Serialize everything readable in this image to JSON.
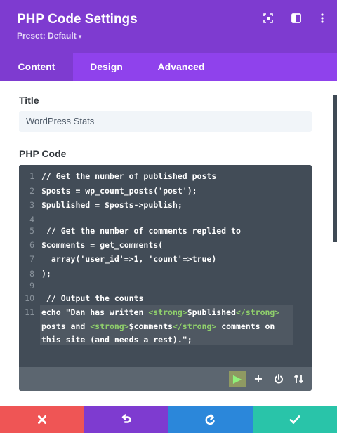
{
  "header": {
    "title": "PHP Code Settings",
    "preset": "Preset: Default",
    "preset_caret": "▾",
    "icons": [
      "focus-icon",
      "split-view-icon",
      "more-options-icon"
    ]
  },
  "tabs": [
    {
      "label": "Content",
      "active": true
    },
    {
      "label": "Design",
      "active": false
    },
    {
      "label": "Advanced",
      "active": false
    }
  ],
  "content": {
    "title_label": "Title",
    "title_value": "WordPress Stats",
    "code_label": "PHP Code",
    "code_lines": [
      {
        "n": "1",
        "text": "// Get the number of published posts"
      },
      {
        "n": "2",
        "text": "$posts = wp_count_posts('post');"
      },
      {
        "n": "3",
        "text": "$published = $posts->publish;"
      },
      {
        "n": "4",
        "text": ""
      },
      {
        "n": "5",
        "text": " // Get the number of comments replied to"
      },
      {
        "n": "6",
        "text": "$comments = get_comments("
      },
      {
        "n": "7",
        "text": "  array('user_id'=>1, 'count'=>true)"
      },
      {
        "n": "8",
        "text": ");"
      },
      {
        "n": "9",
        "text": ""
      },
      {
        "n": "10",
        "text": " // Output the counts"
      },
      {
        "n": "11",
        "text": "echo \"Dan has written <strong>$published</strong>"
      },
      {
        "n": "",
        "text": "posts and <strong>$comments</strong> comments on"
      },
      {
        "n": "",
        "text": "this site (and needs a rest).\";"
      }
    ],
    "code_toolbar": [
      "play-icon",
      "plus-icon",
      "power-icon",
      "sort-icon"
    ]
  },
  "footer": {
    "buttons": [
      {
        "name": "discard-button",
        "icon": "close-icon",
        "color": "#ef5555"
      },
      {
        "name": "undo-button",
        "icon": "undo-icon",
        "color": "#7e3bd0"
      },
      {
        "name": "redo-button",
        "icon": "redo-icon",
        "color": "#2b87da"
      },
      {
        "name": "save-button",
        "icon": "check-icon",
        "color": "#29c4a9"
      }
    ]
  },
  "colors": {
    "accent": "#7e3bd0",
    "tab_bar": "#8f42ec",
    "code_bg": "#424c57",
    "tag_green": "#8fcf6b"
  }
}
